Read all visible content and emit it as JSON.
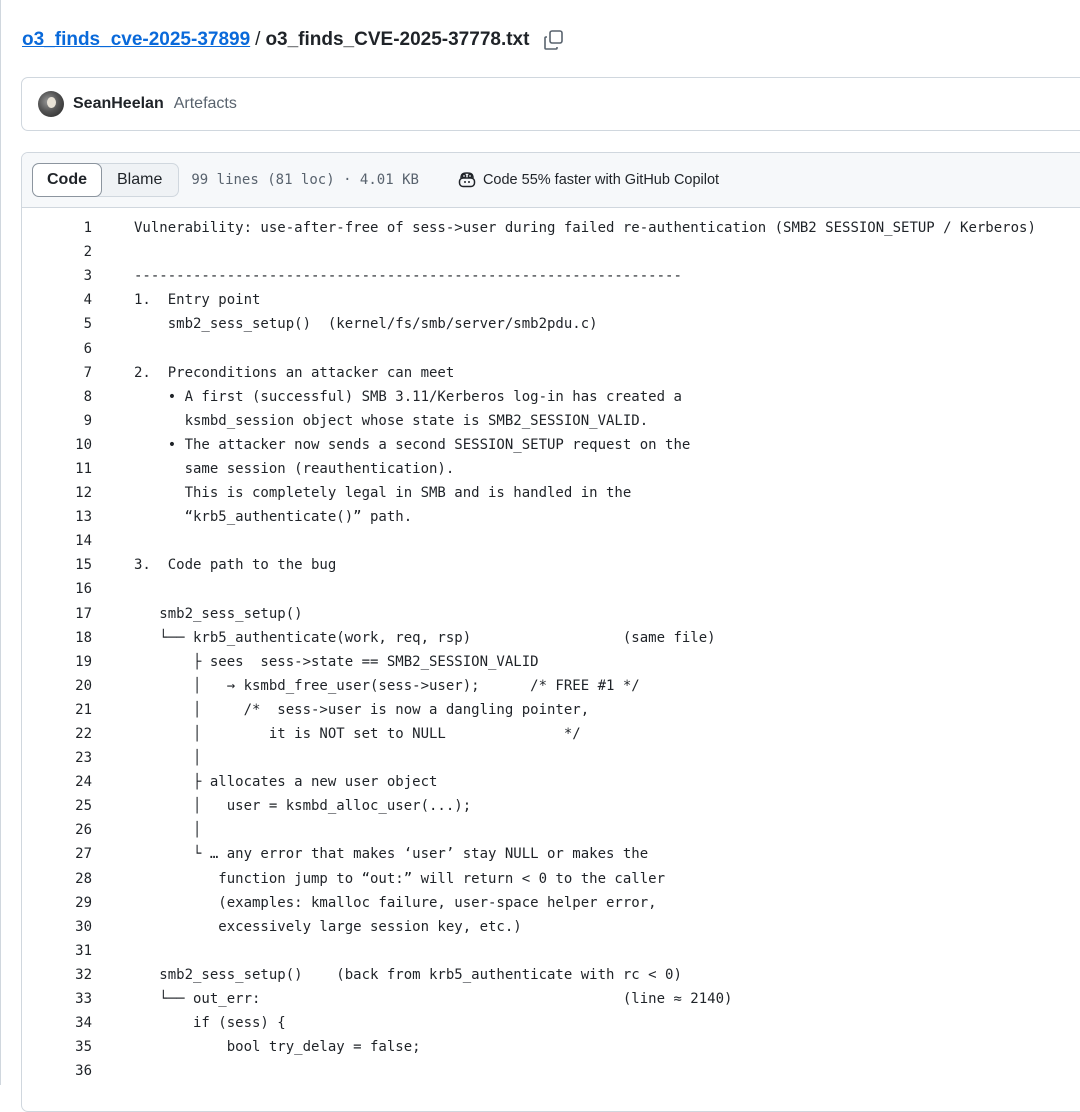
{
  "breadcrumb": {
    "repo": "o3_finds_cve-2025-37899",
    "separator": "/",
    "file": "o3_finds_CVE-2025-37778.txt"
  },
  "commit": {
    "author": "SeanHeelan",
    "message": "Artefacts"
  },
  "file_header": {
    "tabs": [
      {
        "label": "Code",
        "active": true
      },
      {
        "label": "Blame",
        "active": false
      }
    ],
    "meta": "99 lines (81 loc) · 4.01 KB",
    "copilot": "Code 55% faster with GitHub Copilot"
  },
  "icons": {
    "copy": "copy-icon",
    "copilot": "copilot-icon"
  },
  "code": [
    {
      "n": "1",
      "t": "Vulnerability: use-after-free of sess->user during failed re-authentication (SMB2 SESSION_SETUP / Kerberos)"
    },
    {
      "n": "2",
      "t": ""
    },
    {
      "n": "3",
      "t": "-----------------------------------------------------------------"
    },
    {
      "n": "4",
      "t": "1.  Entry point"
    },
    {
      "n": "5",
      "t": "    smb2_sess_setup()  (kernel/fs/smb/server/smb2pdu.c)"
    },
    {
      "n": "6",
      "t": ""
    },
    {
      "n": "7",
      "t": "2.  Preconditions an attacker can meet"
    },
    {
      "n": "8",
      "t": "    • A first (successful) SMB 3.11/Kerberos log-in has created a"
    },
    {
      "n": "9",
      "t": "      ksmbd_session object whose state is SMB2_SESSION_VALID."
    },
    {
      "n": "10",
      "t": "    • The attacker now sends a second SESSION_SETUP request on the"
    },
    {
      "n": "11",
      "t": "      same session (reauthentication)."
    },
    {
      "n": "12",
      "t": "      This is completely legal in SMB and is handled in the"
    },
    {
      "n": "13",
      "t": "      “krb5_authenticate()” path."
    },
    {
      "n": "14",
      "t": ""
    },
    {
      "n": "15",
      "t": "3.  Code path to the bug"
    },
    {
      "n": "16",
      "t": ""
    },
    {
      "n": "17",
      "t": "   smb2_sess_setup()"
    },
    {
      "n": "18",
      "t": "   └── krb5_authenticate(work, req, rsp)                  (same file)"
    },
    {
      "n": "19",
      "t": "       ├ sees  sess->state == SMB2_SESSION_VALID"
    },
    {
      "n": "20",
      "t": "       │   → ksmbd_free_user(sess->user);      /* FREE #1 */"
    },
    {
      "n": "21",
      "t": "       │     /*  sess->user is now a dangling pointer,"
    },
    {
      "n": "22",
      "t": "       │        it is NOT set to NULL              */"
    },
    {
      "n": "23",
      "t": "       │"
    },
    {
      "n": "24",
      "t": "       ├ allocates a new user object"
    },
    {
      "n": "25",
      "t": "       │   user = ksmbd_alloc_user(...);"
    },
    {
      "n": "26",
      "t": "       │"
    },
    {
      "n": "27",
      "t": "       └ … any error that makes ‘user’ stay NULL or makes the"
    },
    {
      "n": "28",
      "t": "          function jump to “out:” will return < 0 to the caller"
    },
    {
      "n": "29",
      "t": "          (examples: kmalloc failure, user-space helper error,"
    },
    {
      "n": "30",
      "t": "          excessively large session key, etc.)"
    },
    {
      "n": "31",
      "t": ""
    },
    {
      "n": "32",
      "t": "   smb2_sess_setup()    (back from krb5_authenticate with rc < 0)"
    },
    {
      "n": "33",
      "t": "   └── out_err:                                           (line ≈ 2140)"
    },
    {
      "n": "34",
      "t": "       if (sess) {"
    },
    {
      "n": "35",
      "t": "           bool try_delay = false;"
    },
    {
      "n": "36",
      "t": ""
    }
  ]
}
